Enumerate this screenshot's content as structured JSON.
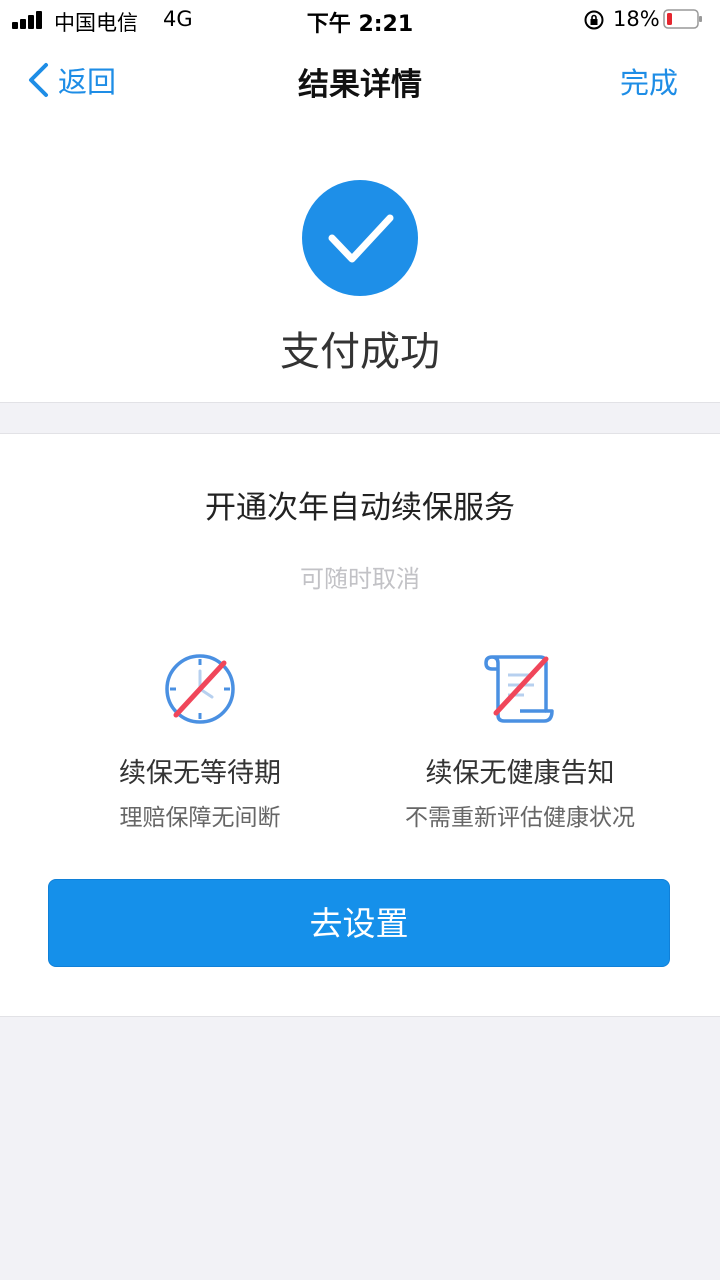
{
  "status_bar": {
    "carrier": "中国电信",
    "network": "4G",
    "time": "下午 2:21",
    "battery": "18%"
  },
  "nav": {
    "back_label": "返回",
    "title": "结果详情",
    "done_label": "完成"
  },
  "result": {
    "title": "支付成功"
  },
  "renew": {
    "title": "开通次年自动续保服务",
    "subtitle": "可随时取消",
    "features": [
      {
        "title": "续保无等待期",
        "desc": "理赔保障无间断",
        "icon": "no-waiting-clock-icon"
      },
      {
        "title": "续保无健康告知",
        "desc": "不需重新评估健康状况",
        "icon": "no-health-notice-scroll-icon"
      }
    ],
    "button_label": "去设置"
  },
  "colors": {
    "accent": "#1590ea",
    "link": "#1e8de6",
    "strike": "#f0465a",
    "background": "#f2f2f6"
  }
}
